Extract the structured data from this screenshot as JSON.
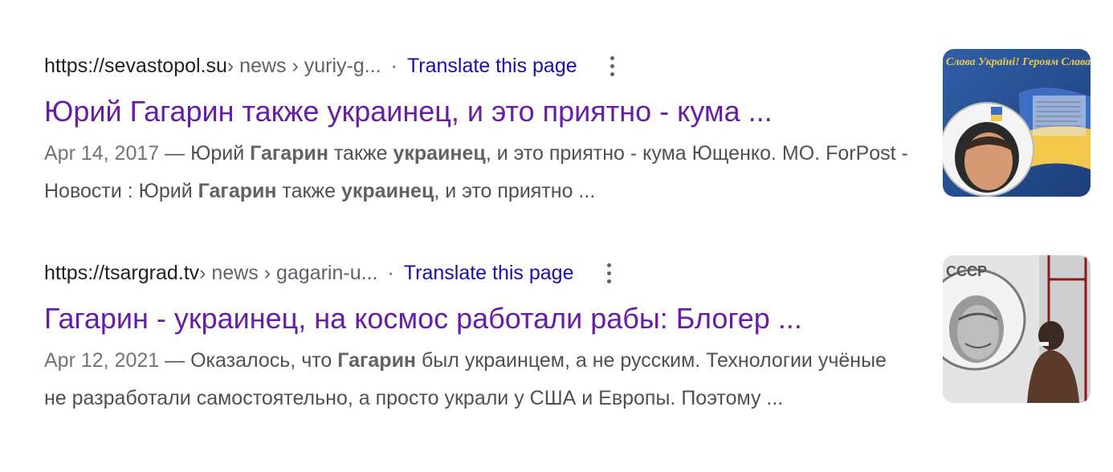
{
  "results": [
    {
      "url_domain": "https://sevastopol.su",
      "url_path": " › news › yuriy-g...",
      "dot": "·",
      "translate": "Translate this page",
      "title": "Юрий Гагарин также украинец, и это приятно - кума ...",
      "date": "Apr 14, 2017",
      "dash": " — ",
      "s1": "Юрий ",
      "s2": "Гагарин",
      "s3": " также ",
      "s4": "украинец",
      "s5": ", и это приятно - кума Ющенко. МО. ForPost - Новости : Юрий ",
      "s6": "Гагарин",
      "s7": " также ",
      "s8": "украинец",
      "s9": ", и это приятно ...",
      "thumb_caption": "Слава Україні! Героям Слава!",
      "thumb_icon": "astronaut-flag-image"
    },
    {
      "url_domain": "https://tsargrad.tv",
      "url_path": " › news › gagarin-u...",
      "dot": "·",
      "translate": "Translate this page",
      "title": "Гагарин - украинец, на космос работали рабы: Блогер ...",
      "date": "Apr 12, 2021",
      "dash": " — ",
      "s1": "Оказалось, что ",
      "s2": "Гагарин",
      "s3": " был украинцем, а не русским. Технологии учёные не разработали самостоятельно, а просто украли у США и Европы. Поэтому ...",
      "thumb_caption": "СССР",
      "thumb_icon": "gagarin-poster-image"
    }
  ],
  "colors": {
    "title_visited": "#681da8",
    "link": "#1a0dab",
    "snippet": "#4d5156",
    "date": "#70757a"
  },
  "icons": {
    "more": "vertical-dots-icon"
  }
}
